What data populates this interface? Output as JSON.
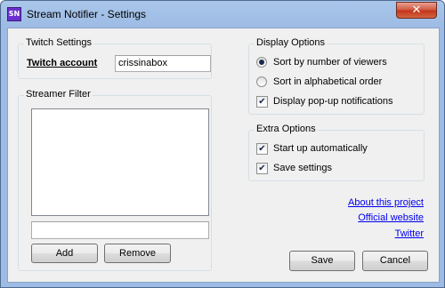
{
  "window": {
    "title": "Stream Notifier - Settings",
    "icon_text": "SN",
    "close_glyph": "✕"
  },
  "twitch_settings": {
    "legend": "Twitch Settings",
    "account_label": "Twitch account",
    "account_value": "crissinabox"
  },
  "streamer_filter": {
    "legend": "Streamer Filter",
    "entry_value": "",
    "add_label": "Add",
    "remove_label": "Remove"
  },
  "display_options": {
    "legend": "Display Options",
    "sort_viewers_label": "Sort by number of viewers",
    "sort_viewers_checked": true,
    "sort_alpha_label": "Sort in alphabetical order",
    "sort_alpha_checked": false,
    "popup_label": "Display pop-up notifications",
    "popup_checked": true
  },
  "extra_options": {
    "legend": "Extra Options",
    "startup_label": "Start up automatically",
    "startup_checked": true,
    "save_settings_label": "Save settings",
    "save_settings_checked": true
  },
  "links": {
    "about": "About this project",
    "website": "Official website",
    "twitter": "Twitter"
  },
  "footer": {
    "save_label": "Save",
    "cancel_label": "Cancel"
  },
  "check_glyph": "✔"
}
